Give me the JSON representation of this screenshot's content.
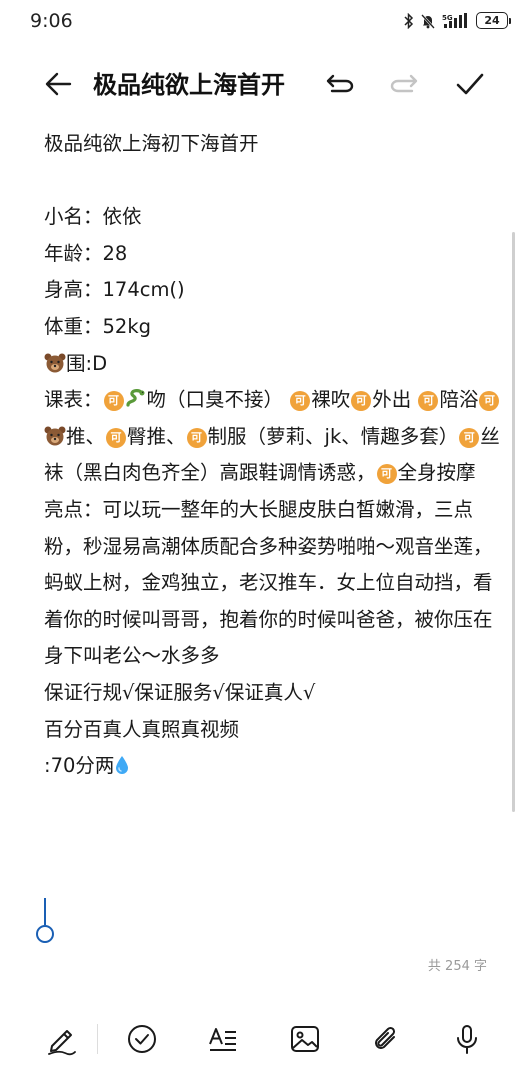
{
  "status_bar": {
    "time": "9:06",
    "network": "5G",
    "battery": "24"
  },
  "toolbar": {
    "title": "极品纯欲上海首开"
  },
  "note": {
    "lines": [
      "极品纯欲上海初下海首开",
      "",
      "小名：依依",
      "年龄：28",
      "身高：174cm()",
      "体重：52kg",
      "围:D",
      "课表：",
      "吻（口臭不接）",
      "裸吹",
      "外出",
      "陪浴",
      "推、",
      "臀推、",
      "制服（萝莉、jk、情趣多套）",
      "丝袜（黑白肉色齐全）高跟鞋调情诱惑，",
      "全身按摩",
      "亮点：可以玩一整年的大长腿皮肤白皙嫩滑，三点粉，秒湿易高潮体质配合多种姿势啪啪～观音坐莲，蚂蚁上树，金鸡独立，老汉推车．女上位自动挡，看着你的时候叫哥哥，抱着你的时候叫爸爸，被你压在身下叫老公～水多多",
      "保证行规√保证服务√保证真人√",
      "百分百真人真照真视频",
      ":70分两"
    ],
    "ke_badge": "可"
  },
  "word_count": "共 254 字",
  "colors": {
    "accent": "#1a5fb4",
    "badge": "#f0a23a",
    "text": "#1a1a1a"
  },
  "icons": [
    "back-arrow-icon",
    "undo-icon",
    "redo-icon",
    "check-icon",
    "pen-icon",
    "checklist-icon",
    "text-format-icon",
    "image-icon",
    "attachment-icon",
    "microphone-icon",
    "bear-emoji-icon",
    "snake-emoji-icon",
    "droplet-emoji-icon"
  ]
}
